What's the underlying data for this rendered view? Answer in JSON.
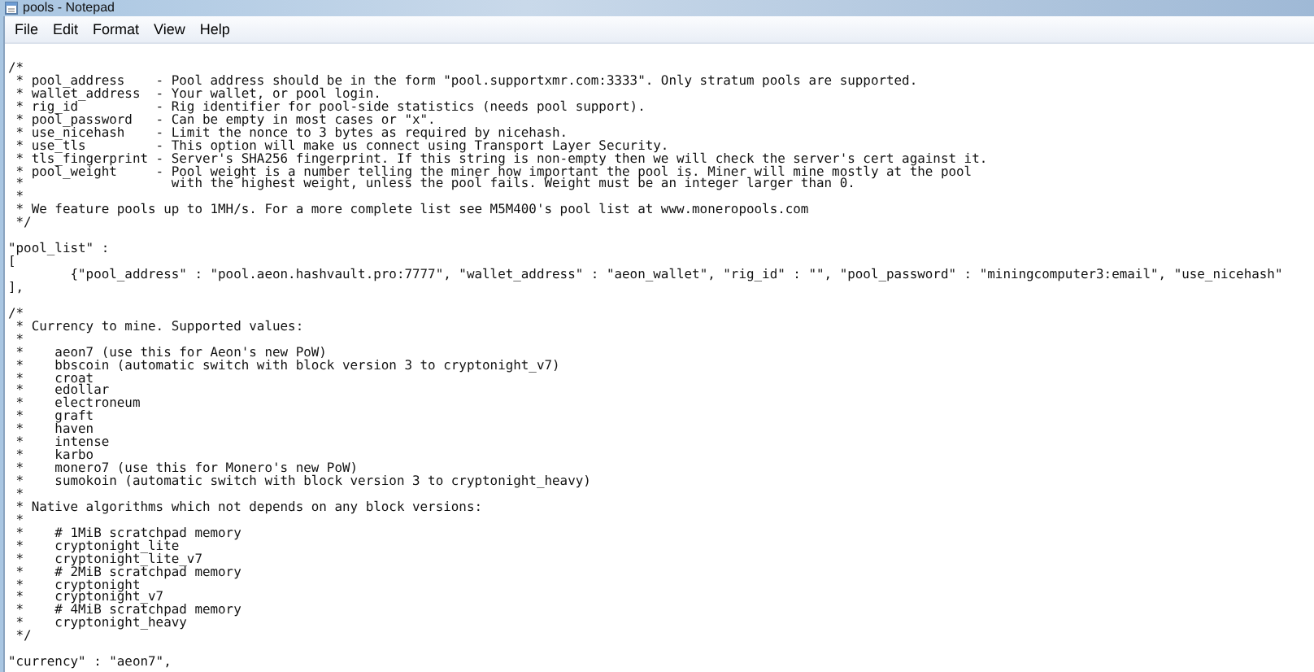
{
  "window": {
    "title": "pools - Notepad"
  },
  "menu": [
    "File",
    "Edit",
    "Format",
    "View",
    "Help"
  ],
  "document": {
    "blocks": [
      [
        "/*",
        " * pool_address    - Pool address should be in the form \"pool.supportxmr.com:3333\". Only stratum pools are supported.",
        " * wallet_address  - Your wallet, or pool login.",
        " * rig_id          - Rig identifier for pool-side statistics (needs pool support).",
        " * pool_password   - Can be empty in most cases or \"x\".",
        " * use_nicehash    - Limit the nonce to 3 bytes as required by nicehash.",
        " * use_tls         - This option will make us connect using Transport Layer Security.",
        " * tls_fingerprint - Server's SHA256 fingerprint. If this string is non-empty then we will check the server's cert against it.",
        " * pool_weight     - Pool weight is a number telling the miner how important the pool is. Miner will mine mostly at the pool",
        " *                   with the highest weight, unless the pool fails. Weight must be an integer larger than 0.",
        " *",
        " * We feature pools up to 1MH/s. For a more complete list see M5M400's pool list at www.moneropools.com",
        " */"
      ],
      [
        "\"pool_list\" :",
        "[",
        "\t{\"pool_address\" : \"pool.aeon.hashvault.pro:7777\", \"wallet_address\" : \"aeon_wallet\", \"rig_id\" : \"\", \"pool_password\" : \"miningcomputer3:email\", \"use_nicehash\"",
        "],"
      ],
      [
        "/*",
        " * Currency to mine. Supported values:",
        " *",
        " *    aeon7 (use this for Aeon's new PoW)",
        " *    bbscoin (automatic switch with block version 3 to cryptonight_v7)",
        " *    croat",
        " *    edollar",
        " *    electroneum",
        " *    graft",
        " *    haven",
        " *    intense",
        " *    karbo",
        " *    monero7 (use this for Monero's new PoW)",
        " *    sumokoin (automatic switch with block version 3 to cryptonight_heavy)",
        " *",
        " * Native algorithms which not depends on any block versions:",
        " *",
        " *    # 1MiB scratchpad memory",
        " *    cryptonight_lite",
        " *    cryptonight_lite_v7",
        " *    # 2MiB scratchpad memory",
        " *    cryptonight",
        " *    cryptonight_v7",
        " *    # 4MiB scratchpad memory",
        " *    cryptonight_heavy",
        " */"
      ],
      [
        "\"currency\" : \"aeon7\","
      ]
    ]
  }
}
